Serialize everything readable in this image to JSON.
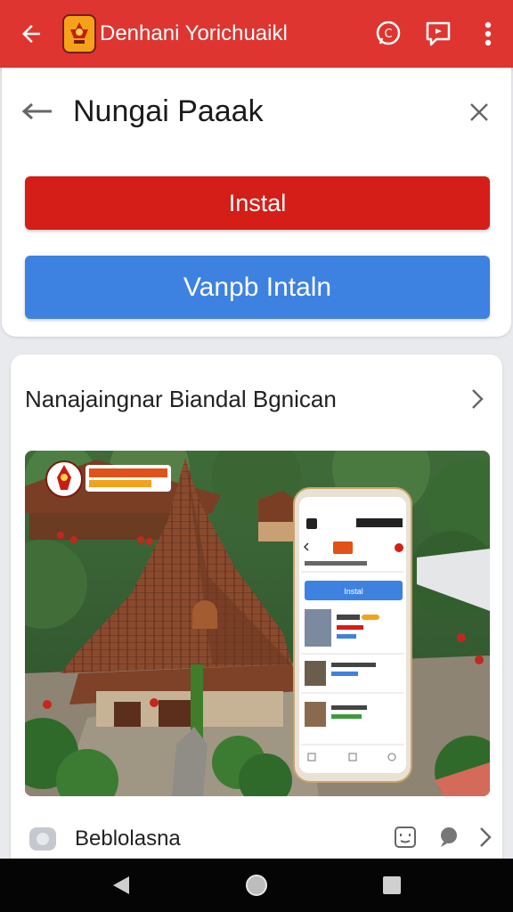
{
  "appbar": {
    "title": "Denhani Yorichuaikl",
    "back_icon": "arrow-back-icon",
    "actions": [
      "whatsapp-icon",
      "feedback-icon",
      "more-vert-icon"
    ],
    "color": "#de3530"
  },
  "card1": {
    "app_name": "Nungai Paaak",
    "install_label": "Instal",
    "other_label": "Vanpb Intaln",
    "install_color": "#d41e17",
    "other_color": "#3d82e0"
  },
  "card2": {
    "heading": "Nanajaingnar Biandal Bgnican",
    "phone": {
      "install_label": "Instal"
    },
    "footer": {
      "label": "Beblolasna"
    }
  },
  "navbar": {
    "buttons": [
      "back-triangle-icon",
      "home-circle-icon",
      "recents-square-icon"
    ]
  }
}
